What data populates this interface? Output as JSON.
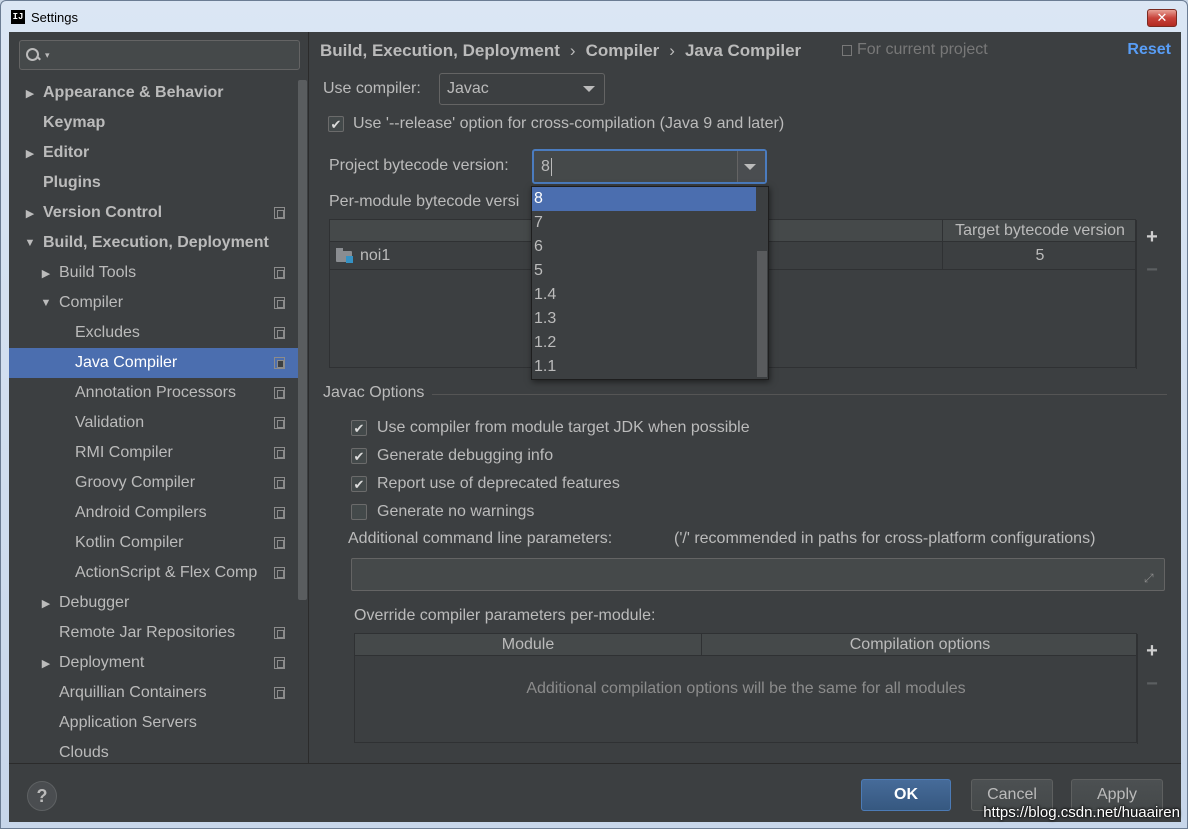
{
  "window": {
    "title": "Settings",
    "app_icon": "IJ",
    "close_icon": "close-icon"
  },
  "sidebar": {
    "items": [
      {
        "label": "Appearance & Behavior",
        "arrow": "▶",
        "bold": true,
        "project_icon": false
      },
      {
        "label": "Keymap",
        "arrow": "",
        "bold": true,
        "project_icon": false
      },
      {
        "label": "Editor",
        "arrow": "▶",
        "bold": true,
        "project_icon": false
      },
      {
        "label": "Plugins",
        "arrow": "",
        "bold": true,
        "project_icon": false
      },
      {
        "label": "Version Control",
        "arrow": "▶",
        "bold": true,
        "project_icon": true
      },
      {
        "label": "Build, Execution, Deployment",
        "arrow": "▼",
        "bold": true,
        "project_icon": false
      },
      {
        "label": "Build Tools",
        "arrow": "▶",
        "bold": false,
        "project_icon": true
      },
      {
        "label": "Compiler",
        "arrow": "▼",
        "bold": false,
        "project_icon": true
      },
      {
        "label": "Excludes",
        "arrow": "",
        "bold": false,
        "project_icon": true
      },
      {
        "label": "Java Compiler",
        "arrow": "",
        "bold": false,
        "project_icon": true,
        "selected": true
      },
      {
        "label": "Annotation Processors",
        "arrow": "",
        "bold": false,
        "project_icon": true
      },
      {
        "label": "Validation",
        "arrow": "",
        "bold": false,
        "project_icon": true
      },
      {
        "label": "RMI Compiler",
        "arrow": "",
        "bold": false,
        "project_icon": true
      },
      {
        "label": "Groovy Compiler",
        "arrow": "",
        "bold": false,
        "project_icon": true
      },
      {
        "label": "Android Compilers",
        "arrow": "",
        "bold": false,
        "project_icon": true
      },
      {
        "label": "Kotlin Compiler",
        "arrow": "",
        "bold": false,
        "project_icon": true
      },
      {
        "label": "ActionScript & Flex Comp",
        "arrow": "",
        "bold": false,
        "project_icon": true
      },
      {
        "label": "Debugger",
        "arrow": "▶",
        "bold": false,
        "project_icon": false
      },
      {
        "label": "Remote Jar Repositories",
        "arrow": "",
        "bold": false,
        "project_icon": true
      },
      {
        "label": "Deployment",
        "arrow": "▶",
        "bold": false,
        "project_icon": true
      },
      {
        "label": "Arquillian Containers",
        "arrow": "",
        "bold": false,
        "project_icon": true
      },
      {
        "label": "Application Servers",
        "arrow": "",
        "bold": false,
        "project_icon": false
      },
      {
        "label": "Clouds",
        "arrow": "",
        "bold": false,
        "project_icon": false
      }
    ]
  },
  "breadcrumb": {
    "parts": [
      "Build, Execution, Deployment",
      "Compiler",
      "Java Compiler"
    ],
    "separator": "›",
    "for_current_project": "For current project",
    "reset": "Reset"
  },
  "compiler": {
    "use_compiler_label": "Use compiler:",
    "use_compiler_value": "Javac",
    "release_option_label": "Use '--release' option for cross-compilation (Java 9 and later)",
    "release_option_checked": true,
    "bytecode_label": "Project bytecode version:",
    "bytecode_value": "8",
    "per_module_label": "Per-module bytecode version:",
    "per_module_visible": "Per-module bytecode versi",
    "module_table": {
      "columns": [
        "",
        "Target bytecode version"
      ],
      "rows": [
        {
          "module": "noi1",
          "target": "5"
        }
      ]
    }
  },
  "bytecode_dropdown": {
    "options": [
      "8",
      "7",
      "6",
      "5",
      "1.4",
      "1.3",
      "1.2",
      "1.1"
    ],
    "selected": "8"
  },
  "javac": {
    "section_title": "Javac Options",
    "options": [
      {
        "label": "Use compiler from module target JDK when possible",
        "checked": true
      },
      {
        "label": "Generate debugging info",
        "checked": true
      },
      {
        "label": "Report use of deprecated features",
        "checked": true
      },
      {
        "label": "Generate no warnings",
        "checked": false
      }
    ],
    "additional_params_label": "Additional command line parameters:",
    "additional_params_hint": "('/' recommended in paths for cross-platform configurations)",
    "additional_params_value": "",
    "override_label": "Override compiler parameters per-module:",
    "override_table": {
      "columns": [
        "Module",
        "Compilation options"
      ],
      "empty_text": "Additional compilation options will be the same for all modules"
    }
  },
  "footer": {
    "help": "?",
    "ok": "OK",
    "cancel": "Cancel",
    "apply": "Apply",
    "watermark": "https://blog.csdn.net/huaairen"
  },
  "colors": {
    "background": "#3c3f41",
    "selection": "#4b6eaf",
    "link": "#589df6",
    "text": "#bbbbbb"
  }
}
